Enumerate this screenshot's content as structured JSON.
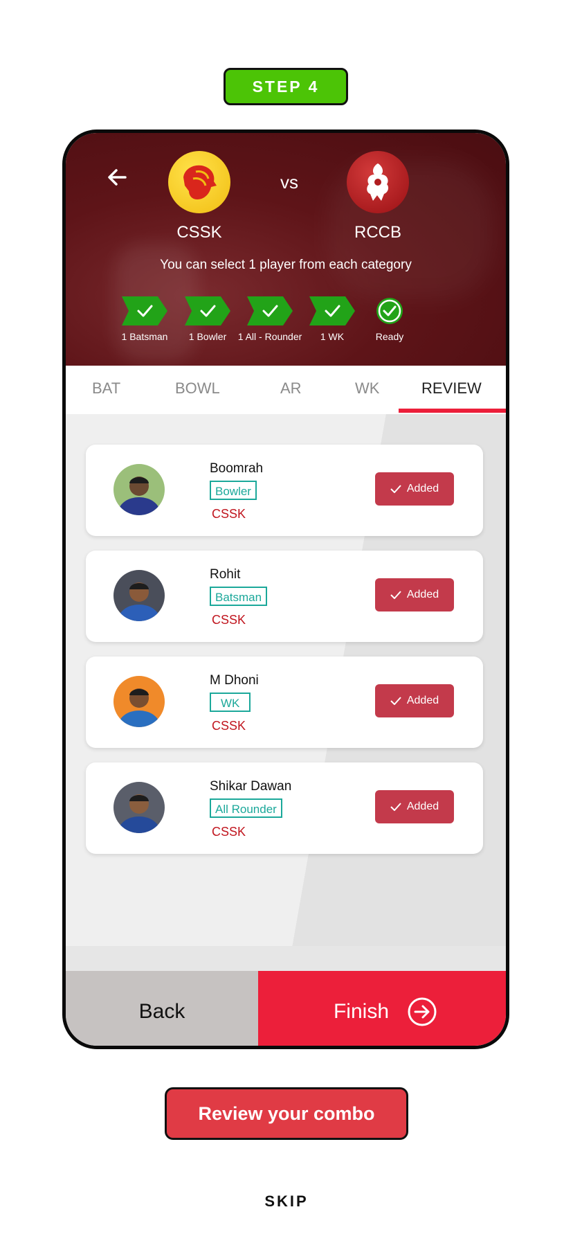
{
  "step_label": "STEP 4",
  "header": {
    "team_a": "CSSK",
    "vs": "vs",
    "team_b": "RCCB",
    "instruction": "You can select 1 player from each category"
  },
  "categories": [
    {
      "label": "1 Batsman"
    },
    {
      "label": "1 Bowler"
    },
    {
      "label": "1 All - Rounder"
    },
    {
      "label": "1 WK"
    },
    {
      "label": "Ready"
    }
  ],
  "tabs": [
    {
      "label": "BAT"
    },
    {
      "label": "BOWL"
    },
    {
      "label": "AR"
    },
    {
      "label": "WK"
    },
    {
      "label": "REVIEW"
    }
  ],
  "players": [
    {
      "name": "Boomrah",
      "role": "Bowler",
      "team": "CSSK",
      "status": "Added",
      "avatar_color": "#2a3a8c"
    },
    {
      "name": "Rohit",
      "role": "Batsman",
      "team": "CSSK",
      "status": "Added",
      "avatar_color": "#4a4e5a"
    },
    {
      "name": "M Dhoni",
      "role": "WK",
      "team": "CSSK",
      "status": "Added",
      "avatar_color": "#f08a2a"
    },
    {
      "name": "Shikar Dawan",
      "role": "All Rounder",
      "team": "CSSK",
      "status": "Added",
      "avatar_color": "#5a5e6a"
    }
  ],
  "buttons": {
    "back": "Back",
    "finish": "Finish",
    "review": "Review your combo",
    "skip": "SKIP"
  },
  "colors": {
    "accent_red": "#ec1f3a",
    "step_green": "#4cc406",
    "added_red": "#c33a4b",
    "role_teal": "#1ba89a",
    "chevron_green": "#22a318"
  }
}
